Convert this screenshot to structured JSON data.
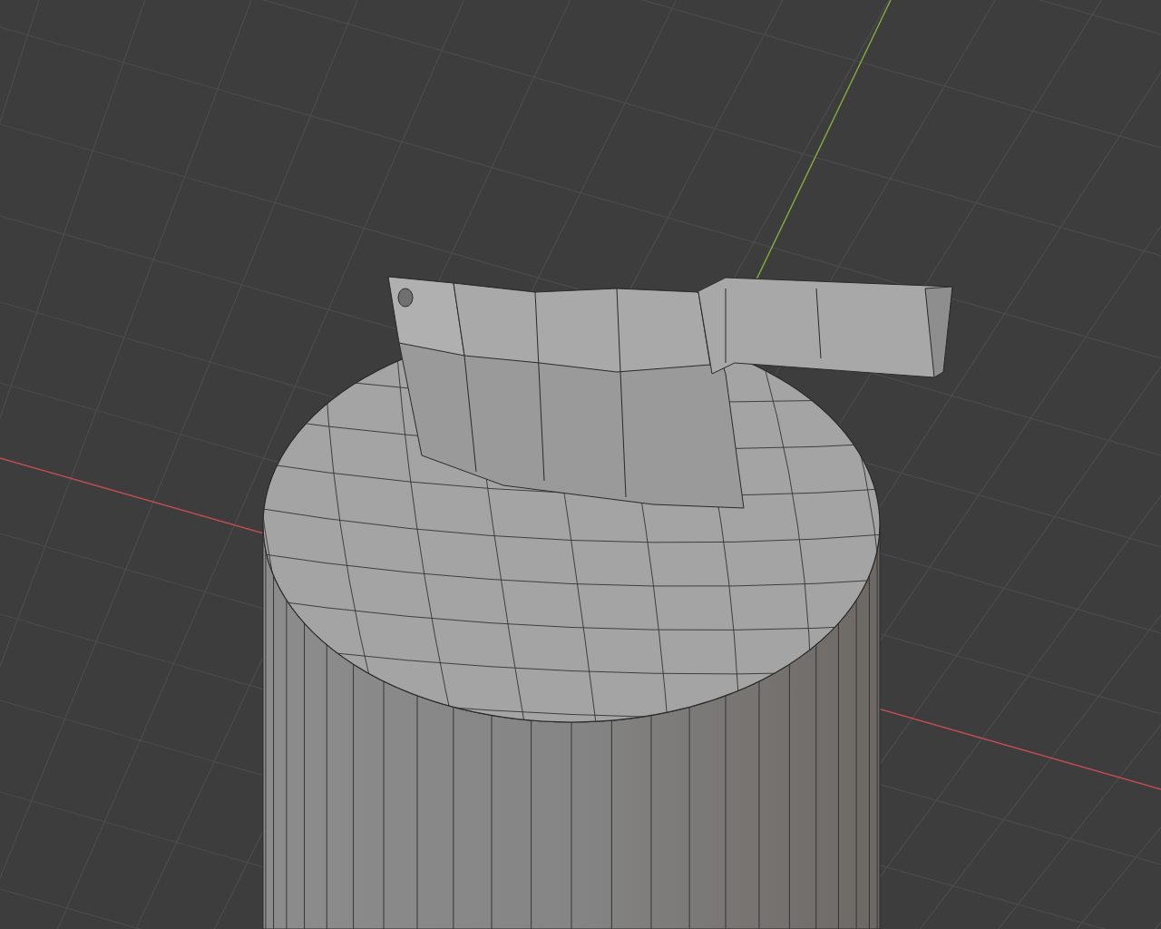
{
  "viewport": {
    "axes": [
      {
        "kind": "x",
        "color": "#c24b55"
      },
      {
        "kind": "y",
        "color": "#86ad3c"
      }
    ]
  }
}
